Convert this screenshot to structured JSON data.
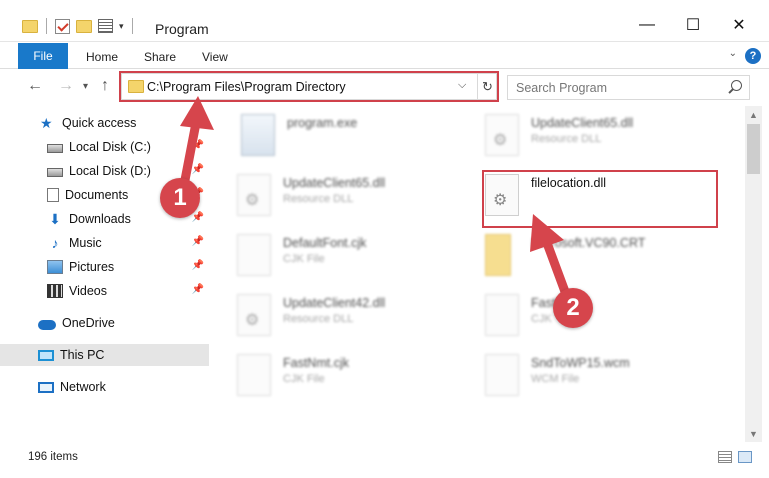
{
  "window": {
    "title": "Program",
    "minimize_glyph": "—",
    "maximize_glyph": "☐",
    "close_glyph": "✕"
  },
  "ribbon": {
    "file_label": "File",
    "tabs": [
      "Home",
      "Share",
      "View"
    ],
    "help_glyph": "?"
  },
  "address": {
    "path": "C:\\Program Files\\Program Directory",
    "refresh_glyph": "↻",
    "dropdown_glyph": "⌵",
    "search_placeholder": "Search Program"
  },
  "nav_pane": {
    "items": [
      {
        "label": "Quick access",
        "icon": "quick-access-icon"
      },
      {
        "label": "Local Disk (C:)",
        "icon": "drive-icon",
        "pinned": true
      },
      {
        "label": "Local Disk (D:)",
        "icon": "drive-icon",
        "pinned": true
      },
      {
        "label": "Documents",
        "icon": "documents-icon",
        "pinned": true
      },
      {
        "label": "Downloads",
        "icon": "downloads-icon",
        "pinned": true
      },
      {
        "label": "Music",
        "icon": "music-icon",
        "pinned": true
      },
      {
        "label": "Pictures",
        "icon": "pictures-icon",
        "pinned": true
      },
      {
        "label": "Videos",
        "icon": "videos-icon",
        "pinned": true
      },
      {
        "label": "OneDrive",
        "icon": "onedrive-icon"
      },
      {
        "label": "This PC",
        "icon": "this-pc-icon",
        "selected": true
      },
      {
        "label": "Network",
        "icon": "network-icon"
      }
    ]
  },
  "files": [
    {
      "name": "program.exe",
      "type": "",
      "icon": "exe-icon"
    },
    {
      "name": "UpdateClient65.dll",
      "type": "Resource DLL",
      "icon": "dll-icon"
    },
    {
      "name": "UpdateClient65.dll",
      "type": "Resource DLL",
      "icon": "dll-icon"
    },
    {
      "name": "filelocation.dll",
      "type": "",
      "icon": "dll-icon",
      "highlighted": true
    },
    {
      "name": "DefaultFont.cjk",
      "type": "CJK File",
      "icon": "file-icon"
    },
    {
      "name": "Microsoft.VC90.CRT",
      "type": "",
      "icon": "folder-icon"
    },
    {
      "name": "UpdateClient42.dll",
      "type": "Resource DLL",
      "icon": "dll-icon"
    },
    {
      "name": "FastNmk",
      "type": "CJK",
      "icon": "file-icon"
    },
    {
      "name": "FastNmt.cjk",
      "type": "CJK File",
      "icon": "file-icon"
    },
    {
      "name": "SndToWP15.wcm",
      "type": "WCM File",
      "icon": "file-icon"
    }
  ],
  "status": {
    "item_count": "196 items"
  },
  "callouts": [
    {
      "label": "1"
    },
    {
      "label": "2"
    }
  ],
  "colors": {
    "accent": "#1979ca",
    "highlight": "#d0414b",
    "badge": "#d6454c"
  }
}
